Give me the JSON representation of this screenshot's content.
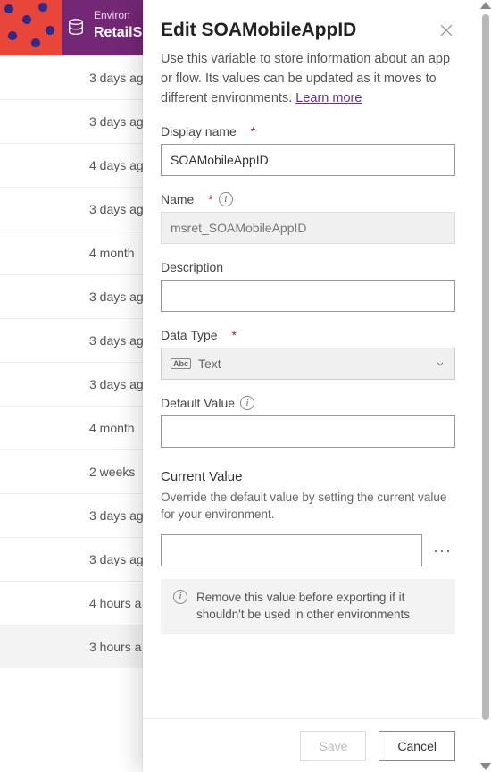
{
  "header": {
    "env_label": "Environ",
    "env_name": "RetailS"
  },
  "bg_rows": [
    "3 days ag",
    "3 days ag",
    "4 days ag",
    "3 days ag",
    "4 month",
    "3 days ag",
    "3 days ag",
    "3 days ag",
    "4 month",
    "2 weeks",
    "3 days ag",
    "3 days ag",
    "4 hours a",
    "3 hours a"
  ],
  "panel": {
    "title": "Edit SOAMobileAppID",
    "help": "Use this variable to store information about an app or flow. Its values can be updated as it moves to different environments. ",
    "learn_more": "Learn more",
    "display_name": {
      "label": "Display name",
      "value": "SOAMobileAppID"
    },
    "name": {
      "label": "Name",
      "value": "msret_SOAMobileAppID"
    },
    "description": {
      "label": "Description",
      "value": ""
    },
    "data_type": {
      "label": "Data Type",
      "value": "Text",
      "prefix": "Abc"
    },
    "default_value": {
      "label": "Default Value",
      "value": ""
    },
    "current_value": {
      "label": "Current Value",
      "help": "Override the default value by setting the current value for your environment.",
      "value": ""
    },
    "warn": "Remove this value before exporting if it shouldn't be used in other environments",
    "save": "Save",
    "cancel": "Cancel"
  }
}
